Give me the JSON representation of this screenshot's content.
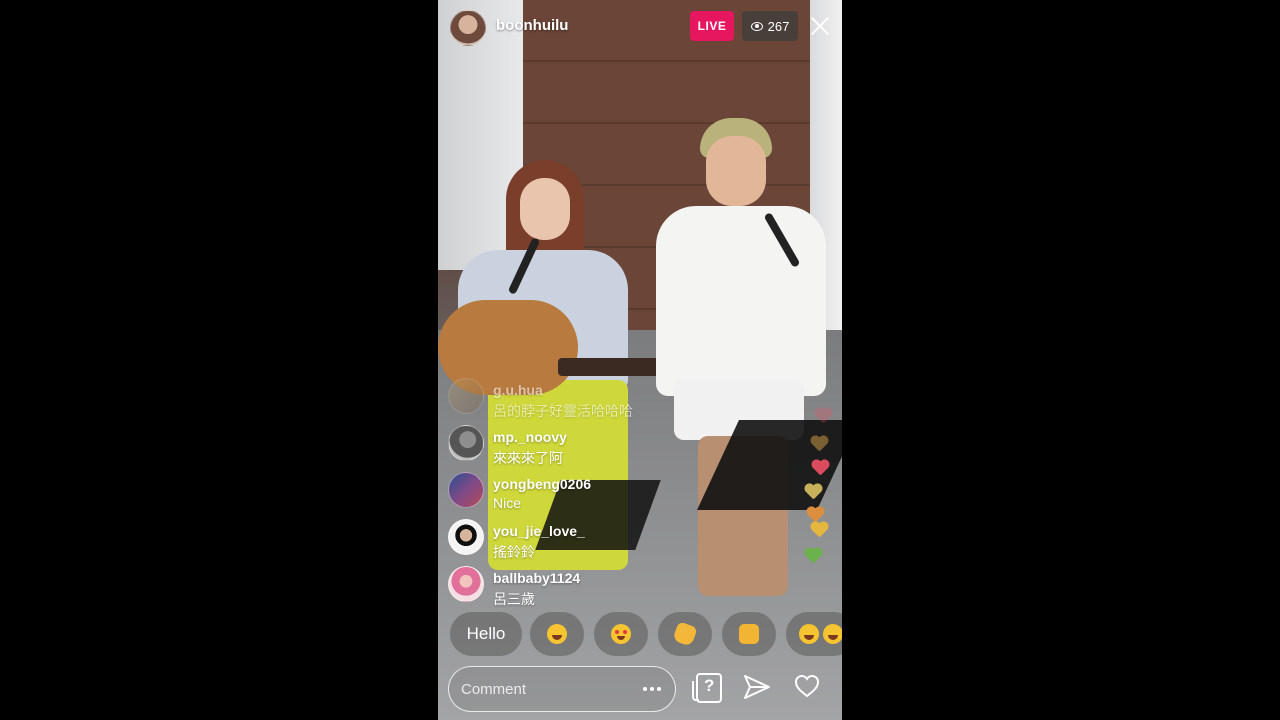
{
  "header": {
    "username": "boonhuilu",
    "live_label": "LIVE",
    "viewer_count": "267"
  },
  "comments": [
    {
      "user": "g.u.hua",
      "text": "呂的脖子好靈活哈哈哈"
    },
    {
      "user": "mp._noovy",
      "text": "來來來了阿"
    },
    {
      "user": "yongbeng0206",
      "text": "Nice"
    },
    {
      "user": "you_jie_love_",
      "text": "搖鈴鈴"
    },
    {
      "user": "ballbaby1124",
      "text": "呂三歲"
    }
  ],
  "quick_reactions": {
    "hello_label": "Hello",
    "emojis": [
      "face-with-tears-of-joy",
      "smiling-face-with-heart-eyes",
      "waving-hand",
      "thumbs-up",
      "face-with-tears-of-joy-double"
    ]
  },
  "hearts_colors": [
    "#ff4d67",
    "#d8a24a",
    "#d94b5d",
    "#c7b25b",
    "#db8e3d",
    "#e6b73f",
    "#6cb24c"
  ],
  "bottom": {
    "comment_placeholder": "Comment",
    "icons": [
      "more-icon",
      "question-icon",
      "send-icon",
      "heart-icon"
    ]
  }
}
